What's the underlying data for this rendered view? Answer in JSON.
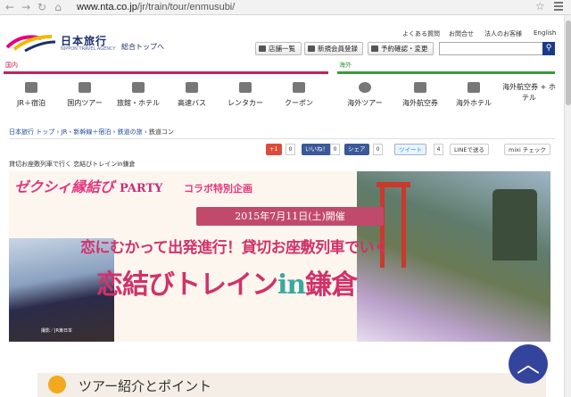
{
  "browser": {
    "url_host": "www.nta.co.jp",
    "url_path": "/jr/train/tour/enmusubi/"
  },
  "header": {
    "logo_name": "日本旅行",
    "logo_sub": "NIPPON TRAVEL AGENCY",
    "top_link": "総合トップへ",
    "util_links": [
      "よくある質問",
      "お問合せ",
      "法人のお客様",
      "English"
    ],
    "buttons": [
      "店舗一覧",
      "新規会員登録",
      "予約確認・変更"
    ],
    "search_placeholder": ""
  },
  "nav": {
    "domestic_label": "国内",
    "overseas_label": "海外",
    "domestic_items": [
      "JR＋宿泊",
      "国内ツアー",
      "旅館・ホテル",
      "高速バス",
      "レンタカー",
      "クーポン"
    ],
    "overseas_items": [
      "海外ツアー",
      "海外航空券",
      "海外ホテル",
      "海外航空券 + ホテル"
    ],
    "domestic_color": "#c0245a",
    "overseas_color": "#3a9a3a"
  },
  "breadcrumb": {
    "items": [
      "日本旅行 トップ",
      "JR・新幹線＋宿泊",
      "鉄道の旅"
    ],
    "current": "鉄道コン"
  },
  "social": {
    "gplus": "+1",
    "gplus_count": "0",
    "fb_like": "いいね！",
    "fb_count": "0",
    "fb_share": "シェア",
    "share_count": "0",
    "tweet": "ツイート",
    "tweet_count": "4",
    "line": "LINEで送る",
    "mixi": "mixi チェック"
  },
  "page_title": "貸切お座敷列車で行く 恋結びトレインin鎌倉",
  "banner": {
    "head": "ゼクシィ縁結び",
    "party": "PARTY",
    "sub": "コラボ特別企画",
    "date": "2015年7月11日(土)開催",
    "line1": "恋にむかって出発進行！貸切お座敷列車でいく",
    "line2_main": "恋結びトレイン",
    "line2_in": "in",
    "line2_place": "鎌倉",
    "caption": "撮影／JR東日本"
  },
  "section": {
    "title": "ツアー紹介とポイント"
  },
  "to_top": "︿"
}
